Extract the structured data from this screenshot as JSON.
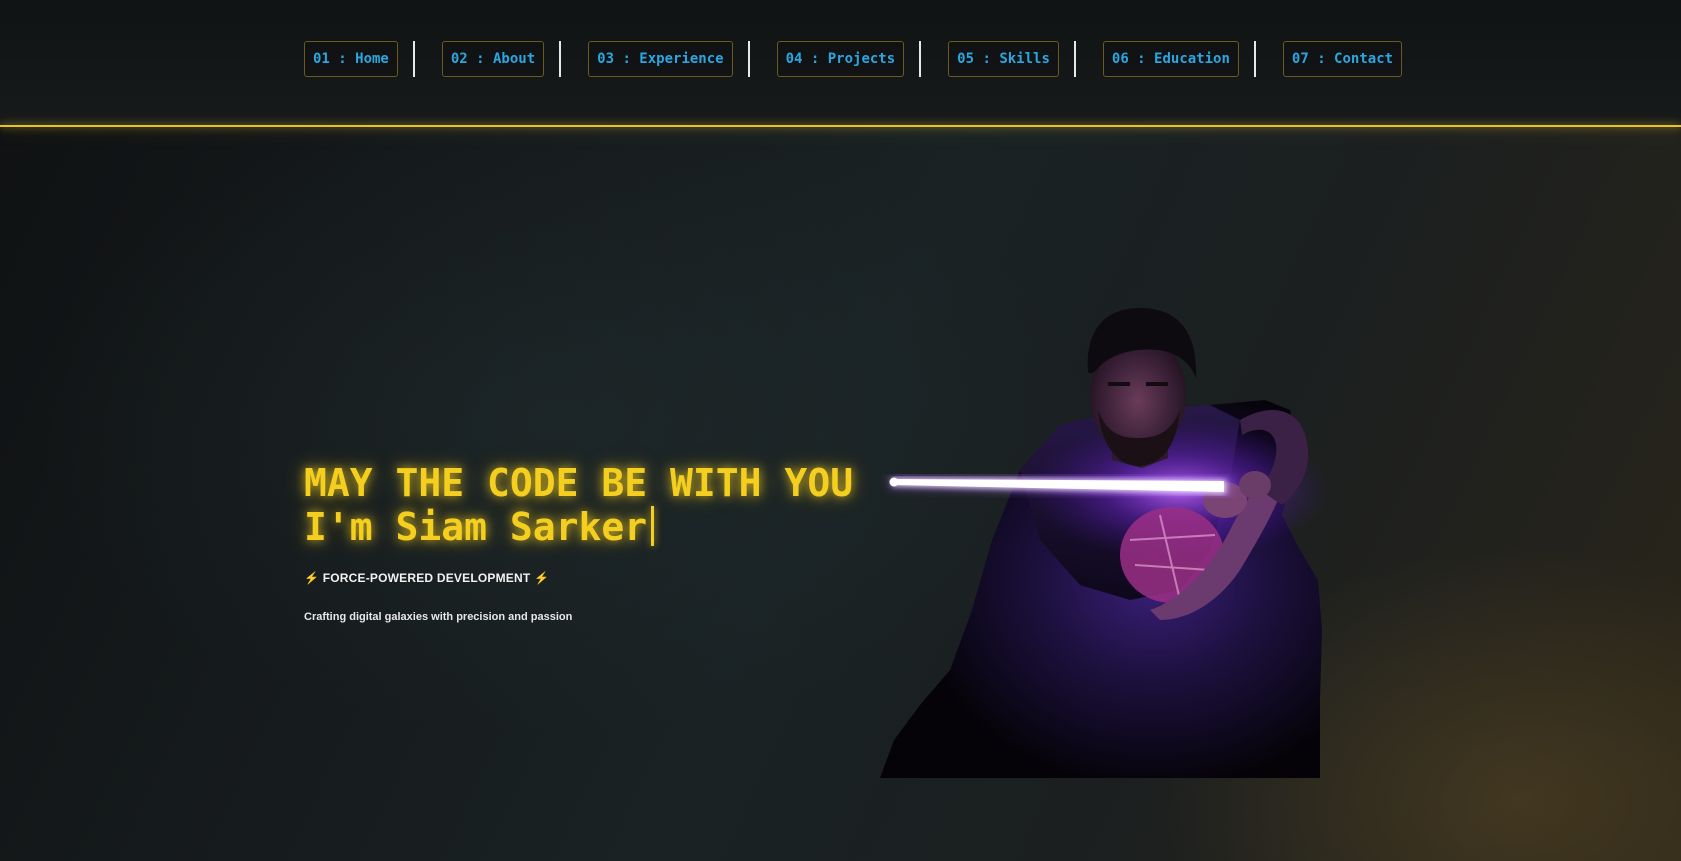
{
  "nav": {
    "items": [
      {
        "label": "01 : Home"
      },
      {
        "label": "02 : About"
      },
      {
        "label": "03 : Experience"
      },
      {
        "label": "04 : Projects"
      },
      {
        "label": "05 : Skills"
      },
      {
        "label": "06 : Education"
      },
      {
        "label": "07 : Contact"
      }
    ]
  },
  "hero": {
    "headline": "MAY THE CODE BE WITH YOU",
    "intro": "I'm Siam Sarker",
    "tagline_bolt_icon": "lightning-icon",
    "tagline": "FORCE-POWERED DEVELOPMENT",
    "subtitle": "Crafting digital galaxies with precision and passion",
    "photo_icon": "portrait-with-lightsaber"
  },
  "colors": {
    "accent_yellow": "#f5cf1f",
    "nav_text_blue": "#2ba6e0",
    "saber_purple": "#a23cff"
  }
}
